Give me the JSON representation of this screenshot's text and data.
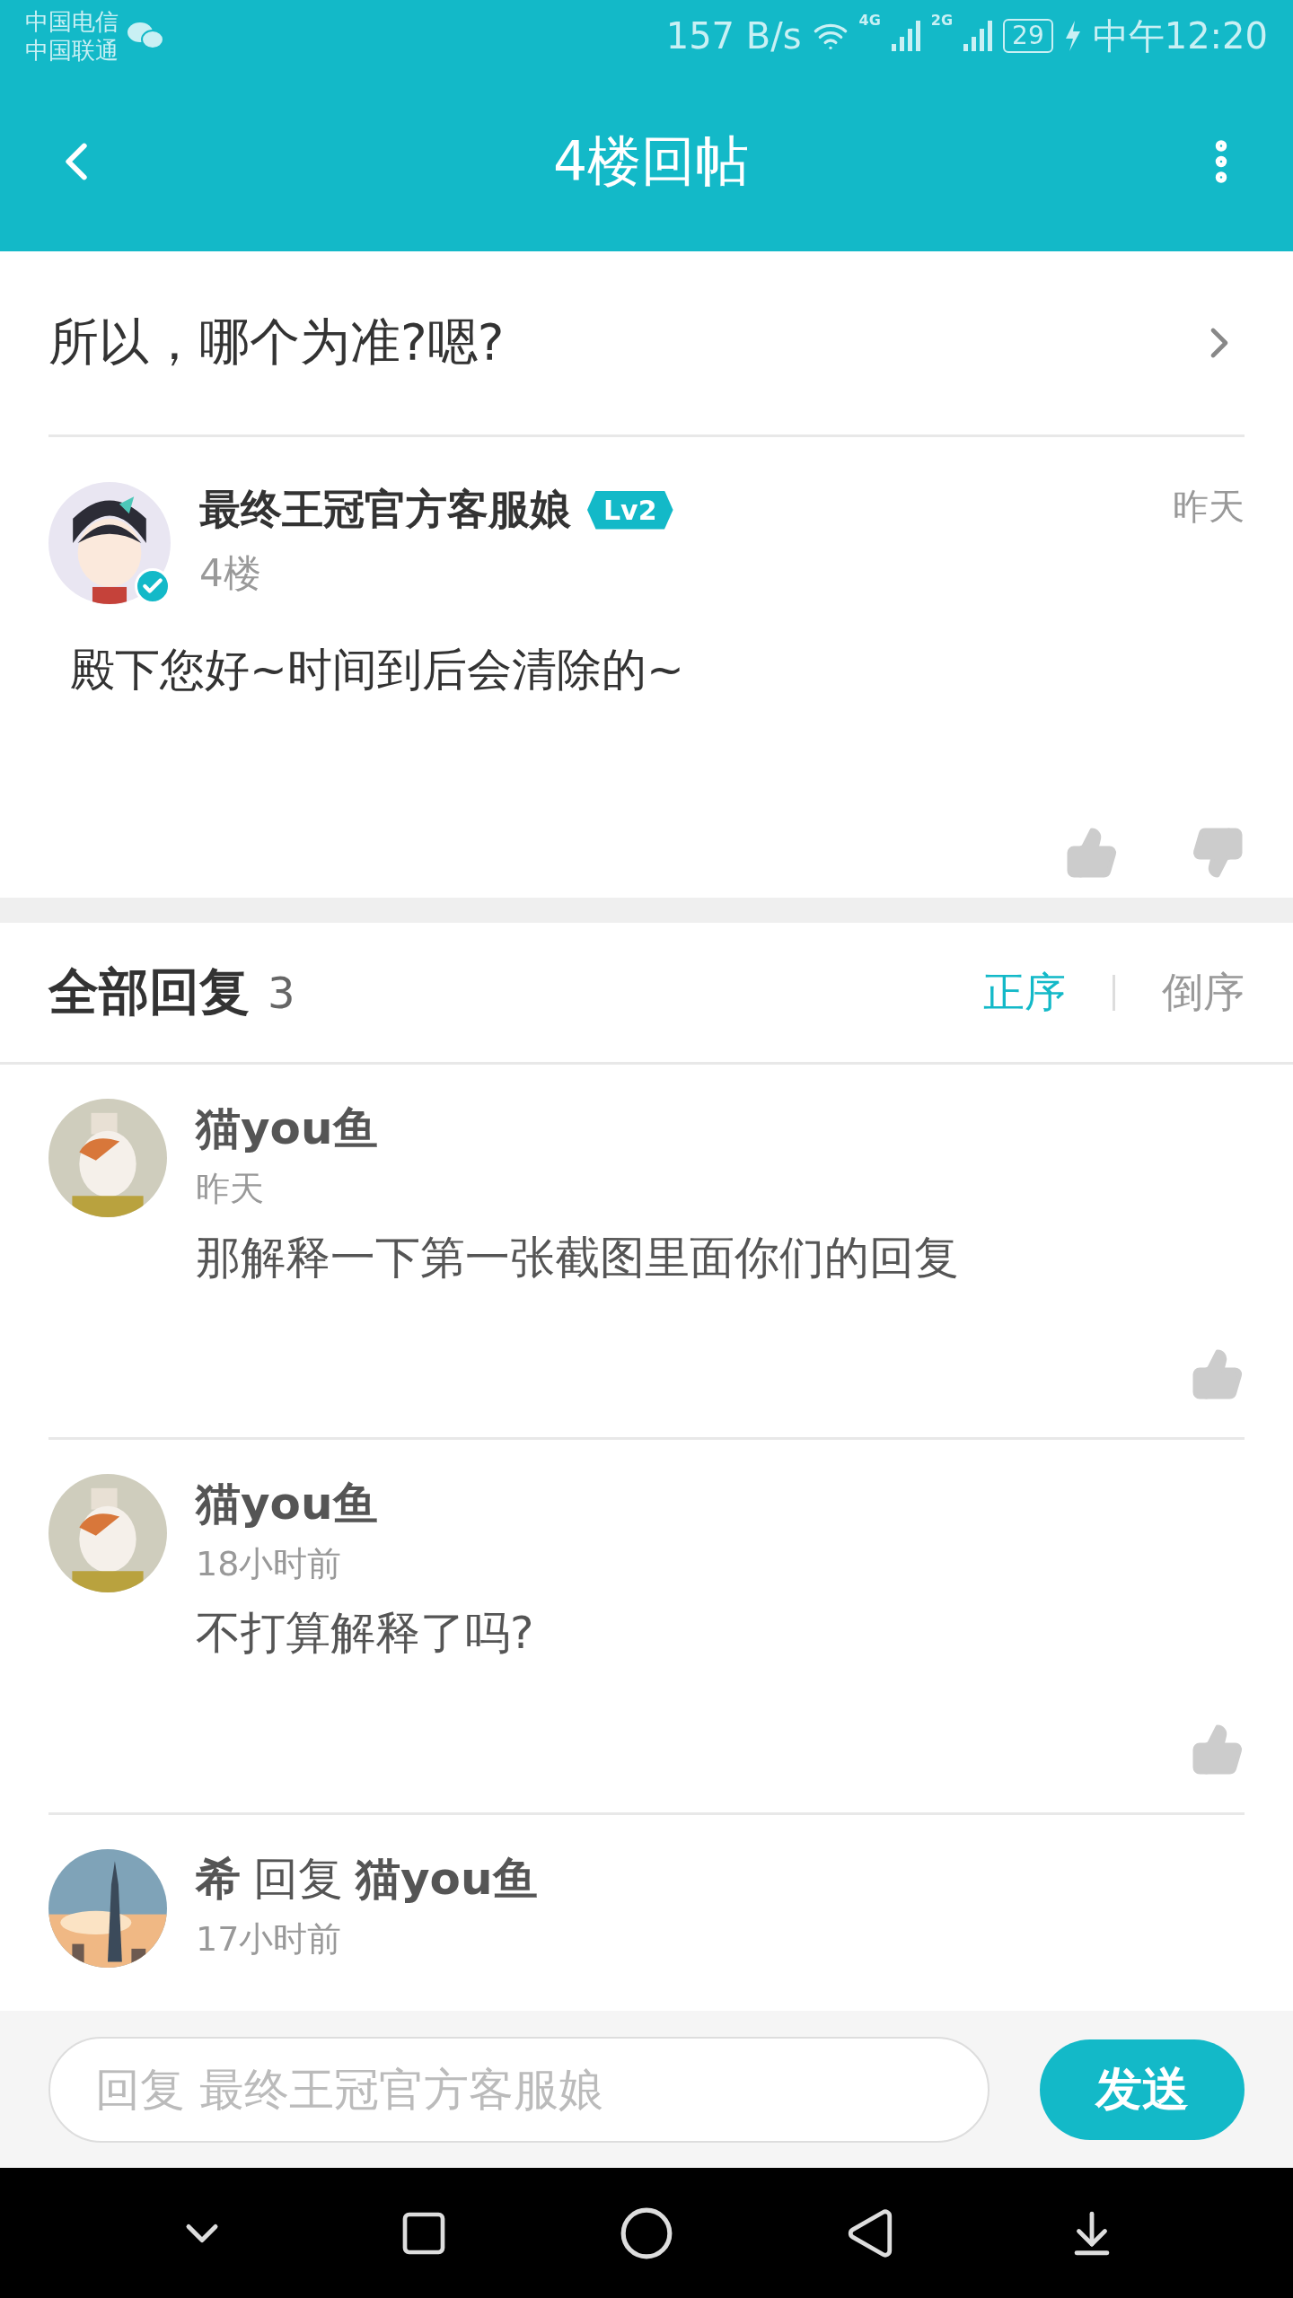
{
  "status_bar": {
    "carriers": [
      "中国电信",
      "中国联通"
    ],
    "speed": "157 B/s",
    "net_4g": "4G",
    "net_2g": "2G",
    "battery": "29",
    "time": "中午12:20"
  },
  "header": {
    "title": "4楼回帖"
  },
  "thread": {
    "title": "所以，哪个为准?嗯?"
  },
  "post": {
    "author": "最终王冠官方客服娘",
    "badge": "Lv2",
    "verified": true,
    "floor": "4楼",
    "time": "昨天",
    "body": "殿下您好~时间到后会清除的~"
  },
  "replies_header": {
    "title": "全部回复",
    "count": "3",
    "sort": [
      {
        "label": "正序",
        "selected": true
      },
      {
        "label": "倒序",
        "selected": false
      }
    ]
  },
  "replies": [
    {
      "author": "猫you鱼",
      "time": "昨天",
      "body": "那解释一下第一张截图里面你们的回复"
    },
    {
      "author": "猫you鱼",
      "time": "18小时前",
      "body": "不打算解释了吗?"
    },
    {
      "author": "希",
      "reply_word": "回复",
      "reply_to": "猫you鱼",
      "time": "17小时前"
    }
  ],
  "composer": {
    "placeholder": "回复 最终王冠官方客服娘",
    "send": "发送"
  }
}
